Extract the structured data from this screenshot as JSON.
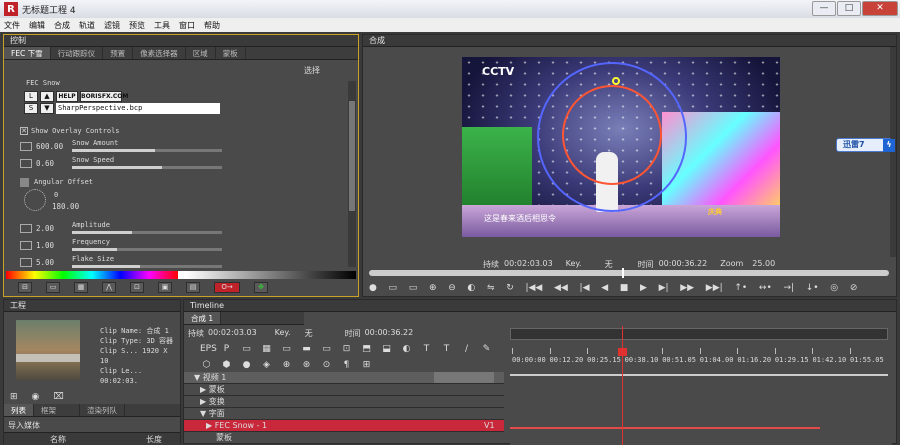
{
  "window": {
    "title": "无标题工程 4",
    "min": "—",
    "max": "□",
    "close": "✕"
  },
  "menu": [
    "文件",
    "编辑",
    "合成",
    "轨道",
    "滤镜",
    "预览",
    "工具",
    "窗口",
    "帮助"
  ],
  "control": {
    "header": "控制",
    "tabs": [
      "FEC 下雪",
      "行动跟踪仪",
      "预置",
      "像素选择器",
      "区域",
      "蒙板"
    ],
    "select_label": "选择",
    "effect_name": "FEC Snow",
    "help_btn": "HELP",
    "site_btn": "BORISFX.COM",
    "file_value": "SharpPerspective.bcp",
    "overlay_label": "Show Overlay Controls",
    "params": [
      {
        "value": "600.00",
        "label": "Snow Amount",
        "fill": 0.55
      },
      {
        "value": "0.60",
        "label": "Snow Speed",
        "fill": 0.6
      }
    ],
    "angular_label": "Angular Offset",
    "angular_top": "0",
    "angular_value": "180.00",
    "params2": [
      {
        "value": "2.00",
        "label": "Amplitude",
        "fill": 0.4
      },
      {
        "value": "1.00",
        "label": "Frequency",
        "fill": 0.3
      },
      {
        "value": "5.00",
        "label": "Flake Size",
        "fill": 0.45
      }
    ],
    "bottom_icons": [
      "⊟",
      "▭",
      "▦",
      "⋀",
      "⊡",
      "▣",
      "▤",
      "O→",
      "✥"
    ]
  },
  "composite": {
    "header": "合成",
    "video_logo": "CCTV",
    "subtitle": "这是春来酒后相思令",
    "stage_sign": "庆典",
    "duration_label": "持续",
    "duration": "00:02:03.03",
    "key_label": "Key.",
    "key_value": "无",
    "time_label": "时间",
    "time": "00:00:36.22",
    "zoom_label": "Zoom",
    "zoom": "25.00",
    "transport": [
      "●",
      "▭",
      "▭",
      "⊕",
      "⊖",
      "◐",
      "⇋",
      "↻",
      "|◀◀",
      "◀◀",
      "|◀",
      "◀",
      "■",
      "▶",
      "▶|",
      "▶▶",
      "▶▶|",
      "↑•",
      "↔•",
      "→|",
      "↓•",
      "◎",
      "⊘"
    ]
  },
  "xunlei": {
    "label": "迅雷7"
  },
  "project": {
    "header": "工程",
    "clip_name": "Clip Name: 合成 1",
    "clip_type": "Clip Type: 3D 容器",
    "clip_size": "Clip S...  1920 X 10",
    "clip_len": "Clip Le...  00:02:03.",
    "tabs": [
      "列表",
      "框架",
      "渲染列队"
    ],
    "sub_header": "导入媒体",
    "col_name": "名称",
    "col_len": "长度"
  },
  "timeline": {
    "header": "Timeline",
    "tab": "合成 1",
    "duration_label": "持续",
    "duration": "00:02:03.03",
    "key_label": "Key.",
    "key_value": "无",
    "time_label": "时间",
    "time": "00:00:36.22",
    "toolbar_icons": [
      "EPS",
      "P",
      "▭",
      "▦",
      "▭",
      "▬",
      "▭",
      "⊡",
      "⬒",
      "⬓",
      "◐",
      "T",
      "T",
      "∕",
      "✎",
      "⬡",
      "⬢",
      "●",
      "◈",
      "⊕",
      "⊛",
      "⊙",
      "¶",
      "⊞"
    ],
    "ruler": [
      "00:00:00",
      "00:12.20",
      "00:25.15",
      "00:38.10",
      "00:51.05",
      "01:04.00",
      "01:16.20",
      "01:29.15",
      "01:42.10",
      "01:55.05"
    ],
    "tracks": [
      {
        "name": "视频 1",
        "indent": 0,
        "caret": "▼"
      },
      {
        "name": "蒙板",
        "indent": 1,
        "caret": "▶"
      },
      {
        "name": "变换",
        "indent": 1,
        "caret": "▶"
      },
      {
        "name": "字面",
        "indent": 1,
        "caret": "▼"
      },
      {
        "name": "FEC Snow - 1",
        "indent": 2,
        "caret": "▶"
      },
      {
        "name": "蒙板",
        "indent": 3,
        "caret": ""
      }
    ],
    "track_tag": "V1"
  }
}
